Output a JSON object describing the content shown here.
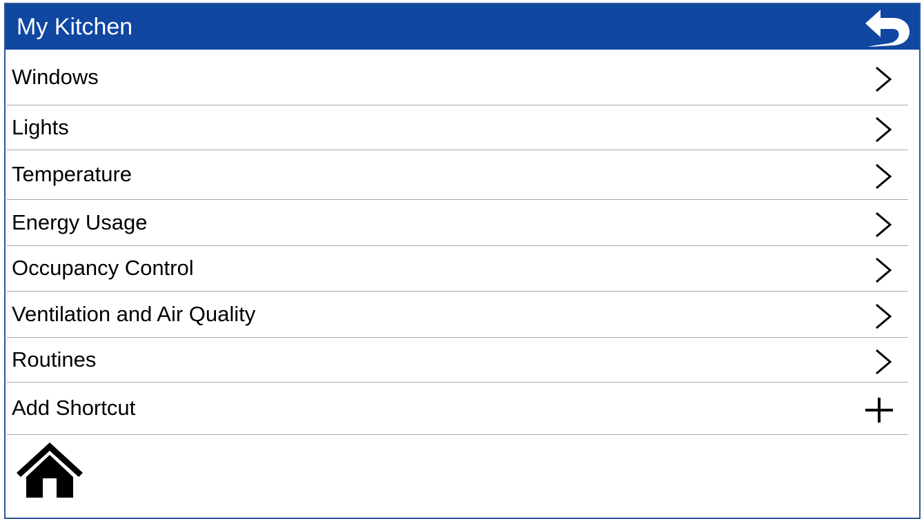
{
  "header": {
    "title": "My Kitchen",
    "back_icon": "back-arrow-icon"
  },
  "menu": {
    "items": [
      {
        "label": "Windows",
        "icon": "chevron-right-icon"
      },
      {
        "label": "Lights",
        "icon": "chevron-right-icon"
      },
      {
        "label": "Temperature",
        "icon": "chevron-right-icon"
      },
      {
        "label": "Energy Usage",
        "icon": "chevron-right-icon"
      },
      {
        "label": "Occupancy Control",
        "icon": "chevron-right-icon"
      },
      {
        "label": "Ventilation and Air Quality",
        "icon": "chevron-right-icon"
      },
      {
        "label": "Routines",
        "icon": "chevron-right-icon"
      },
      {
        "label": "Add Shortcut",
        "icon": "plus-icon"
      }
    ]
  },
  "footer": {
    "home_icon": "home-icon"
  },
  "colors": {
    "header_bg": "#0f47a1",
    "border": "#2f5597"
  }
}
